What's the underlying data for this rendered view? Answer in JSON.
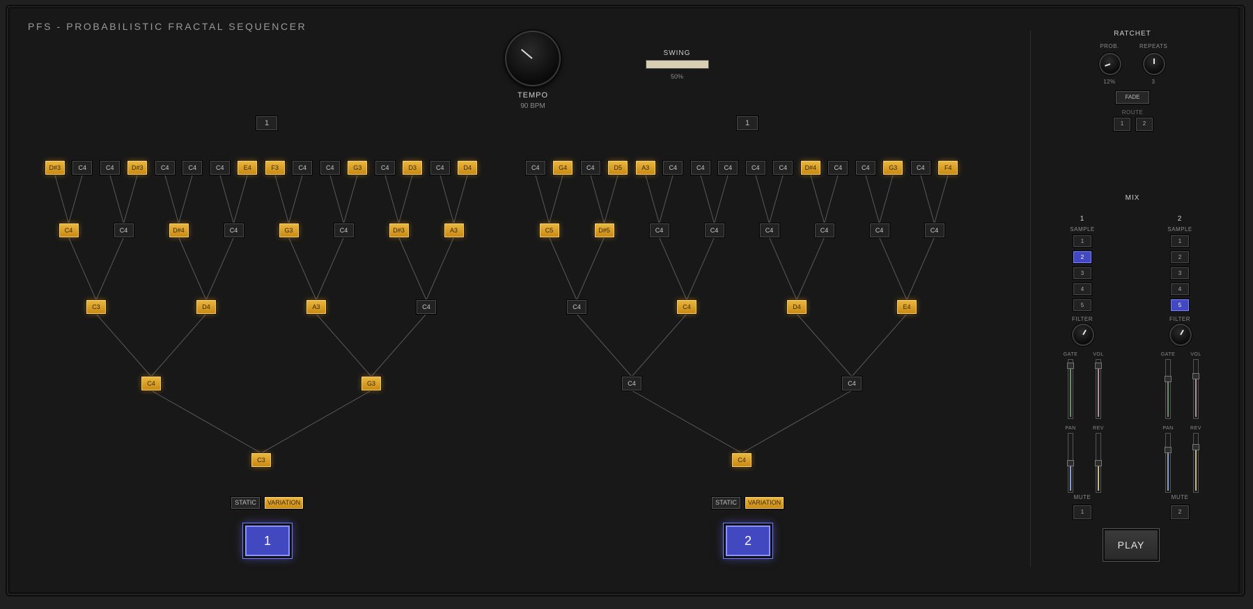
{
  "app": {
    "title": "PFS - PROBABILISTIC FRACTAL SEQUENCER"
  },
  "tempo": {
    "label": "TEMPO",
    "value_text": "90 BPM"
  },
  "swing": {
    "label": "SWING",
    "value_text": "50%",
    "value": 0.5
  },
  "sequencers": [
    {
      "channel_label": "1",
      "trigger_label": "1",
      "modes": [
        {
          "label": "STATIC",
          "active": false
        },
        {
          "label": "VARIATION",
          "active": true
        }
      ],
      "levels": [
        [
          {
            "n": "C3",
            "on": true
          }
        ],
        [
          {
            "n": "C4",
            "on": true
          },
          {
            "n": "G3",
            "on": true
          }
        ],
        [
          {
            "n": "C3",
            "on": true
          },
          {
            "n": "D4",
            "on": true
          },
          {
            "n": "A3",
            "on": true
          },
          {
            "n": "C4",
            "on": false
          }
        ],
        [
          {
            "n": "C4",
            "on": true
          },
          {
            "n": "C4",
            "on": false
          },
          {
            "n": "D#4",
            "on": true
          },
          {
            "n": "C4",
            "on": false
          },
          {
            "n": "G3",
            "on": true
          },
          {
            "n": "C4",
            "on": false
          },
          {
            "n": "D#3",
            "on": true
          },
          {
            "n": "A3",
            "on": true
          }
        ],
        [
          {
            "n": "D#3",
            "on": true
          },
          {
            "n": "C4",
            "on": false
          },
          {
            "n": "C4",
            "on": false
          },
          {
            "n": "D#3",
            "on": true
          },
          {
            "n": "C4",
            "on": false
          },
          {
            "n": "C4",
            "on": false
          },
          {
            "n": "C4",
            "on": false
          },
          {
            "n": "E4",
            "on": true
          },
          {
            "n": "F3",
            "on": true
          },
          {
            "n": "C4",
            "on": false
          },
          {
            "n": "C4",
            "on": false
          },
          {
            "n": "G3",
            "on": true
          },
          {
            "n": "C4",
            "on": false
          },
          {
            "n": "D3",
            "on": true
          },
          {
            "n": "C4",
            "on": false
          },
          {
            "n": "D4",
            "on": true
          }
        ]
      ]
    },
    {
      "channel_label": "1",
      "trigger_label": "2",
      "modes": [
        {
          "label": "STATIC",
          "active": false
        },
        {
          "label": "VARIATION",
          "active": true
        }
      ],
      "levels": [
        [
          {
            "n": "C4",
            "on": true
          }
        ],
        [
          {
            "n": "C4",
            "on": false
          },
          {
            "n": "C4",
            "on": false
          }
        ],
        [
          {
            "n": "C4",
            "on": false
          },
          {
            "n": "C4",
            "on": true
          },
          {
            "n": "D4",
            "on": true
          },
          {
            "n": "E4",
            "on": true
          }
        ],
        [
          {
            "n": "C5",
            "on": true
          },
          {
            "n": "D#5",
            "on": true
          },
          {
            "n": "C4",
            "on": false
          },
          {
            "n": "C4",
            "on": false
          },
          {
            "n": "C4",
            "on": false
          },
          {
            "n": "C4",
            "on": false
          },
          {
            "n": "C4",
            "on": false
          },
          {
            "n": "C4",
            "on": false
          }
        ],
        [
          {
            "n": "C4",
            "on": false
          },
          {
            "n": "G4",
            "on": true
          },
          {
            "n": "C4",
            "on": false
          },
          {
            "n": "D5",
            "on": true
          },
          {
            "n": "A3",
            "on": true
          },
          {
            "n": "C4",
            "on": false
          },
          {
            "n": "C4",
            "on": false
          },
          {
            "n": "C4",
            "on": false
          },
          {
            "n": "C4",
            "on": false
          },
          {
            "n": "C4",
            "on": false
          },
          {
            "n": "D#4",
            "on": true
          },
          {
            "n": "C4",
            "on": false
          },
          {
            "n": "C4",
            "on": false
          },
          {
            "n": "G3",
            "on": true
          },
          {
            "n": "C4",
            "on": false
          },
          {
            "n": "F4",
            "on": true
          }
        ]
      ]
    }
  ],
  "ratchet": {
    "title": "RATCHET",
    "prob": {
      "label": "PROB.",
      "value_text": "12%",
      "value": 0.12
    },
    "repeats": {
      "label": "REPEATS",
      "value_text": "3"
    },
    "fade_label": "FADE",
    "route": {
      "label": "ROUTE",
      "buttons": [
        "1",
        "2"
      ]
    }
  },
  "mix": {
    "title": "MIX",
    "channels": [
      {
        "label": "1",
        "sample_label": "SAMPLE",
        "samples": [
          "1",
          "2",
          "3",
          "4",
          "5"
        ],
        "selected_sample": "2",
        "filter_label": "FILTER",
        "gate_label": "GATE",
        "vol_label": "VOL",
        "pan_label": "PAN",
        "rev_label": "REV",
        "gate": 0.95,
        "vol": 0.95,
        "pan": 0.5,
        "rev": 0.5,
        "mute_label": "MUTE",
        "mute_button": "1"
      },
      {
        "label": "2",
        "sample_label": "SAMPLE",
        "samples": [
          "1",
          "2",
          "3",
          "4",
          "5"
        ],
        "selected_sample": "5",
        "filter_label": "FILTER",
        "gate_label": "GATE",
        "vol_label": "VOL",
        "pan_label": "PAN",
        "rev_label": "REV",
        "gate": 0.7,
        "vol": 0.75,
        "pan": 0.75,
        "rev": 0.8,
        "mute_label": "MUTE",
        "mute_button": "2"
      }
    ]
  },
  "play_label": "PLAY",
  "colors": {
    "accent_on": "#e0a62c",
    "trigger_blue": "#4148c0",
    "gate_fill": "#6b8f6b",
    "vol_fill": "#b0909a",
    "pan_fill": "#8aa0c8",
    "rev_fill": "#c8b890"
  }
}
